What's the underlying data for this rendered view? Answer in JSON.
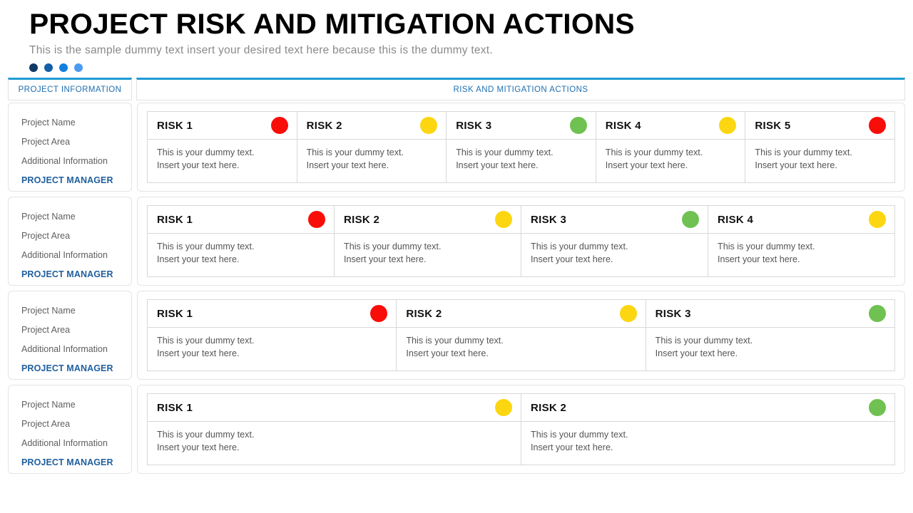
{
  "header": {
    "title": "PROJECT RISK AND MITIGATION ACTIONS",
    "subtitle": "This is the sample dummy text insert your desired text here because this is the dummy text.",
    "dots": [
      "#103a66",
      "#1360a8",
      "#0f7fe0",
      "#4b9bf0"
    ]
  },
  "tabs": [
    {
      "label": "PROJECT INFORMATION"
    },
    {
      "label": "RISK AND MITIGATION ACTIONS"
    }
  ],
  "colors": {
    "red": "#f90d09",
    "yellow": "#fcd610",
    "green": "#6fc151",
    "tab_accent": "#1f9bd4",
    "tab_text": "#1f6fb0",
    "manager_text": "#1f5f9e"
  },
  "info_panel": {
    "lines": [
      "Project Name",
      "Project Area",
      "Additional Information"
    ],
    "manager": "PROJECT MANAGER"
  },
  "risk_text": {
    "line1": "This is your dummy text.",
    "line2": "Insert your text here."
  },
  "rows": [
    {
      "info": {
        "lines": [
          "Project Name",
          "Project Area",
          "Additional Information"
        ],
        "manager": "PROJECT MANAGER"
      },
      "risks": [
        {
          "label": "RISK 1",
          "status": "red",
          "color": "#f90d09",
          "line1": "This is your dummy text.",
          "line2": "Insert your text here."
        },
        {
          "label": "RISK 2",
          "status": "yellow",
          "color": "#fcd610",
          "line1": "This is your dummy text.",
          "line2": "Insert your text here."
        },
        {
          "label": "RISK 3",
          "status": "green",
          "color": "#6fc151",
          "line1": "This is your dummy text.",
          "line2": "Insert your text here."
        },
        {
          "label": "RISK 4",
          "status": "yellow",
          "color": "#fcd610",
          "line1": "This is your dummy text.",
          "line2": "Insert your text here."
        },
        {
          "label": "RISK 5",
          "status": "red",
          "color": "#f90d09",
          "line1": "This is your dummy text.",
          "line2": "Insert your text here."
        }
      ]
    },
    {
      "info": {
        "lines": [
          "Project Name",
          "Project Area",
          "Additional Information"
        ],
        "manager": "PROJECT MANAGER"
      },
      "risks": [
        {
          "label": "RISK 1",
          "status": "red",
          "color": "#f90d09",
          "line1": "This is your dummy text.",
          "line2": "Insert your text here."
        },
        {
          "label": "RISK 2",
          "status": "yellow",
          "color": "#fcd610",
          "line1": "This is your dummy text.",
          "line2": "Insert your text here."
        },
        {
          "label": "RISK 3",
          "status": "green",
          "color": "#6fc151",
          "line1": "This is your dummy text.",
          "line2": "Insert your text here."
        },
        {
          "label": "RISK 4",
          "status": "yellow",
          "color": "#fcd610",
          "line1": "This is your dummy text.",
          "line2": "Insert your text here."
        }
      ]
    },
    {
      "info": {
        "lines": [
          "Project Name",
          "Project Area",
          "Additional Information"
        ],
        "manager": "PROJECT MANAGER"
      },
      "risks": [
        {
          "label": "RISK 1",
          "status": "red",
          "color": "#f90d09",
          "line1": "This is your dummy text.",
          "line2": "Insert your text here."
        },
        {
          "label": "RISK 2",
          "status": "yellow",
          "color": "#fcd610",
          "line1": "This is your dummy text.",
          "line2": "Insert your text here."
        },
        {
          "label": "RISK 3",
          "status": "green",
          "color": "#6fc151",
          "line1": "This is your dummy text.",
          "line2": "Insert your text here."
        }
      ]
    },
    {
      "info": {
        "lines": [
          "Project Name",
          "Project Area",
          "Additional Information"
        ],
        "manager": "PROJECT MANAGER"
      },
      "risks": [
        {
          "label": "RISK 1",
          "status": "yellow",
          "color": "#fcd610",
          "line1": "This is your dummy text.",
          "line2": "Insert your text here."
        },
        {
          "label": "RISK 2",
          "status": "green",
          "color": "#6fc151",
          "line1": "This is your dummy text.",
          "line2": "Insert your text here."
        }
      ]
    }
  ]
}
